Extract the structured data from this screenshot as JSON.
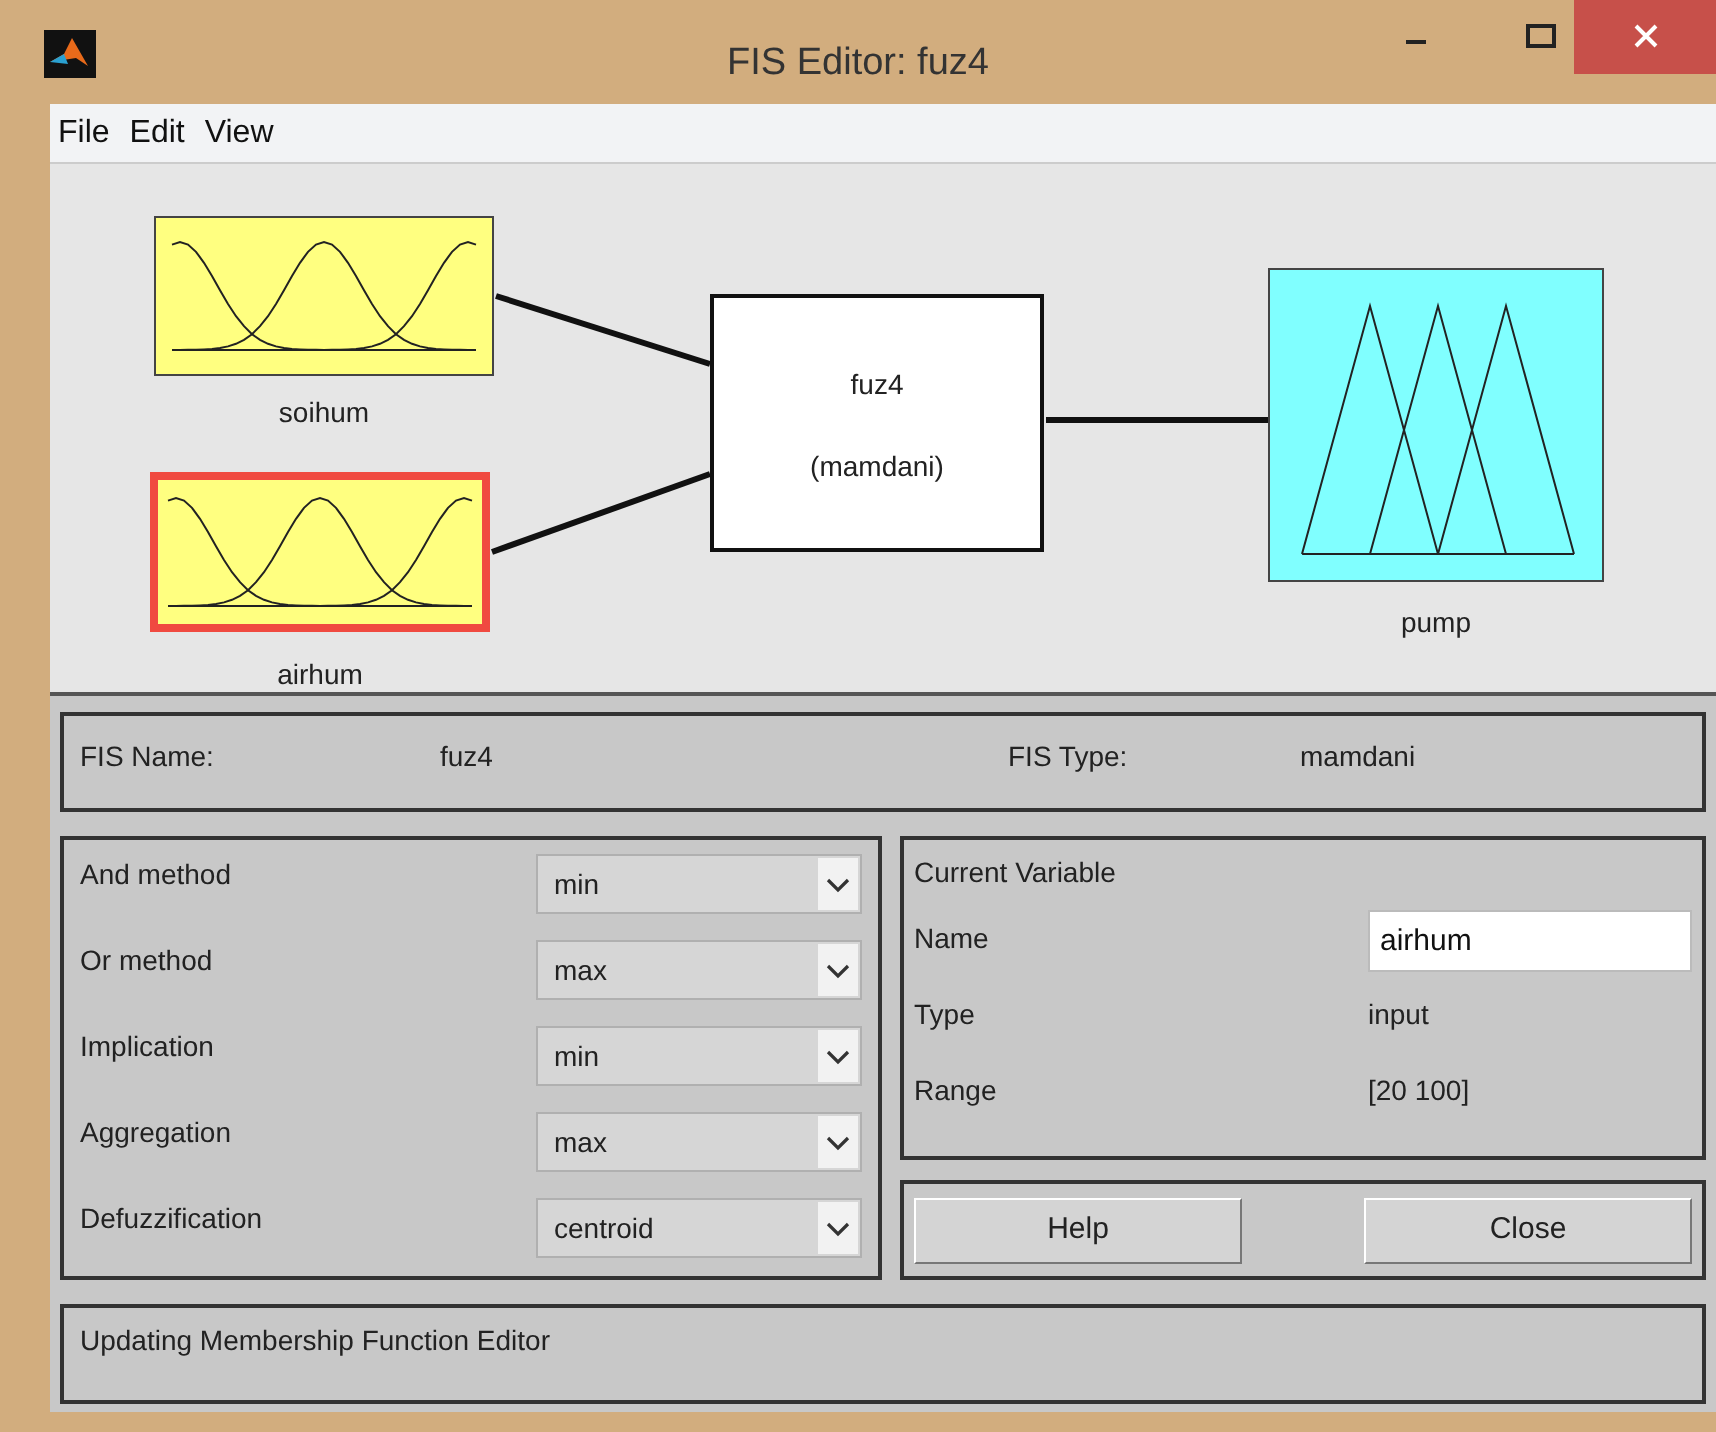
{
  "window": {
    "title": "FIS Editor: fuz4"
  },
  "menu": [
    "File",
    "Edit",
    "View"
  ],
  "diagram": {
    "inputs": [
      {
        "name": "soihum",
        "selected": false
      },
      {
        "name": "airhum",
        "selected": true
      }
    ],
    "system": {
      "name": "fuz4",
      "type": "(mamdani)"
    },
    "outputs": [
      {
        "name": "pump",
        "selected": false
      }
    ]
  },
  "fis": {
    "name_label": "FIS Name:",
    "name": "fuz4",
    "type_label": "FIS Type:",
    "type": "mamdani"
  },
  "methods": [
    {
      "label": "And method",
      "value": "min"
    },
    {
      "label": "Or method",
      "value": "max"
    },
    {
      "label": "Implication",
      "value": "min"
    },
    {
      "label": "Aggregation",
      "value": "max"
    },
    {
      "label": "Defuzzification",
      "value": "centroid"
    }
  ],
  "current_variable": {
    "title": "Current Variable",
    "fields": [
      {
        "label": "Name",
        "value": "airhum",
        "kind": "input"
      },
      {
        "label": "Type",
        "value": "input",
        "kind": "text"
      },
      {
        "label": "Range",
        "value": "[20 100]",
        "kind": "text"
      }
    ]
  },
  "buttons": [
    "Help",
    "Close"
  ],
  "status": "Updating Membership Function Editor"
}
